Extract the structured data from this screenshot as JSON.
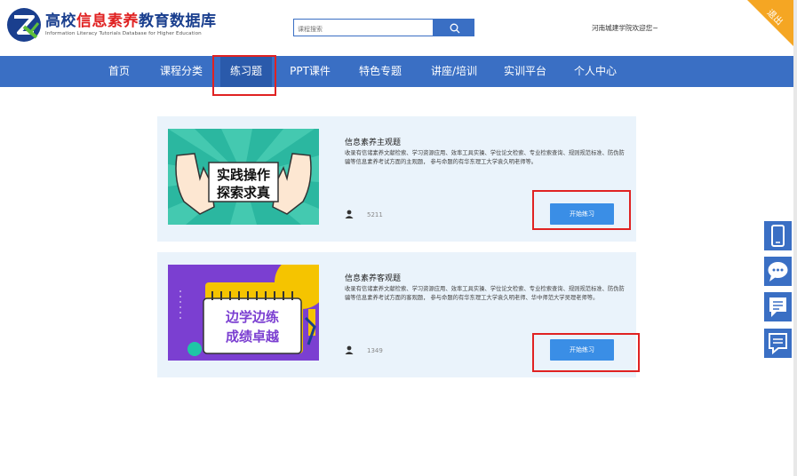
{
  "header": {
    "logo_title_parts": [
      "高校",
      "信息素养",
      "教育数据库"
    ],
    "logo_subtitle": "Information Literacy Tutorials Database for Higher Education",
    "search": {
      "placeholder": "课程搜索"
    },
    "search_icon": "search-icon",
    "welcome": "河南城建学院欢迎您~",
    "logout": "退出"
  },
  "nav": {
    "items": [
      "首页",
      "课程分类",
      "练习题",
      "PPT课件",
      "特色专题",
      "讲座/培训",
      "实训平台",
      "个人中心"
    ],
    "active_index": 2
  },
  "courses": [
    {
      "title": "信息素养主观题",
      "description": "收录有信诸素养文献检索、学习资源应用、效率工具实操、学位论文检索、专业检索查询、规则规范标准、防伪防骗等信息素养考试方面的主观题， 参与命题的有华东理工大学袁久明老师等。",
      "count": "5211",
      "button": "开始练习",
      "image_text": [
        "实践操作",
        "探索求真"
      ]
    },
    {
      "title": "信息素养客观题",
      "description": "收录有信诸素养文献检索、学习资源应用、效率工具实操、学位论文检索、专业检索查询、规则规范标准、防伪防骗等信息素养考试方面的客观题， 参与命题的有华东理工大学袁久明老师、华中师范大学吴理老师等。",
      "count": "1349",
      "button": "开始练习",
      "image_text": [
        "边学边练",
        "成绩卓越"
      ]
    }
  ],
  "side_buttons": [
    "mobile-icon",
    "chat-bubble-icon",
    "comment-icon",
    "message-icon"
  ],
  "colors": {
    "nav_bg": "#3a6fc4",
    "nav_active": "#2a5aab",
    "card_bg": "#eaf3fb",
    "button_bg": "#3a8ee6",
    "highlight": "#e02222",
    "corner": "#f5a623",
    "brand_blue": "#1a3f8e",
    "brand_red": "#e02222"
  }
}
